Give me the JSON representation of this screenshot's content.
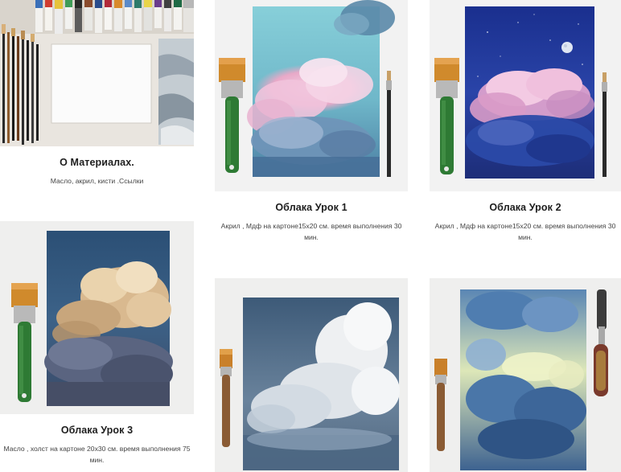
{
  "cards": [
    {
      "title": "О Материалах.",
      "description": "Масло, акрил, кисти .Ссылки"
    },
    {
      "title": "Облака Урок 1",
      "description": "Акрил , Мдф на картоне15х20 см. время выполнения 30 мин."
    },
    {
      "title": "Облака Урок 2",
      "description": "Акрил , Мдф на картоне15х20 см. время выполнения 30 мин."
    },
    {
      "title": "Облака Урок 3",
      "description": "Масло , холст на картоне 20х30 см. время выполнения 75 мин."
    },
    {
      "title": "",
      "description": ""
    },
    {
      "title": "",
      "description": ""
    }
  ],
  "colors": {
    "title_text": "#1e1e1e",
    "description_text": "#444444",
    "background": "#ffffff"
  }
}
